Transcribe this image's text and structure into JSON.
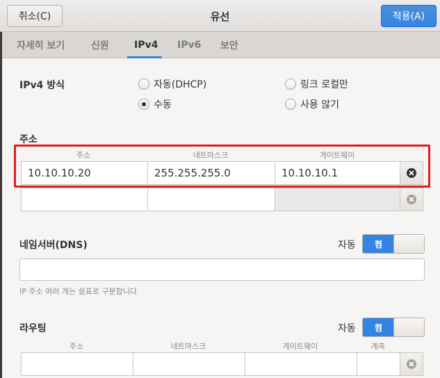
{
  "header": {
    "title": "유선",
    "cancel_label": "취소(C)",
    "apply_label": "적용(A)"
  },
  "tabs": [
    {
      "label": "자세히 보기"
    },
    {
      "label": "신원"
    },
    {
      "label": "IPv4"
    },
    {
      "label": "IPv6"
    },
    {
      "label": "보안"
    }
  ],
  "active_tab": "IPv4",
  "ipv4_method": {
    "label": "IPv4 방식",
    "options": [
      {
        "label": "자동(DHCP)",
        "checked": false
      },
      {
        "label": "링크 로컬만",
        "checked": false
      },
      {
        "label": "수동",
        "checked": true
      },
      {
        "label": "사용 않기",
        "checked": false
      }
    ]
  },
  "addresses": {
    "section_label": "주소",
    "columns": [
      "주소",
      "네트마스크",
      "게이트웨이"
    ],
    "rows": [
      {
        "address": "10.10.10.20",
        "netmask": "255.255.255.0",
        "gateway": "10.10.10.1"
      },
      {
        "address": "",
        "netmask": "",
        "gateway": ""
      }
    ]
  },
  "dns": {
    "label": "네임서버(DNS)",
    "auto_label": "자동",
    "switch_label": "켬",
    "value": "",
    "hint": "IP 주소 여러 개는 쉼표로 구분합니다"
  },
  "routing": {
    "label": "라우팅",
    "auto_label": "자동",
    "switch_label": "켬",
    "columns": [
      "주소",
      "네트마스크",
      "게이트웨이",
      "계측"
    ]
  },
  "colors": {
    "accent": "#3584e4",
    "highlight": "#e31b23"
  }
}
